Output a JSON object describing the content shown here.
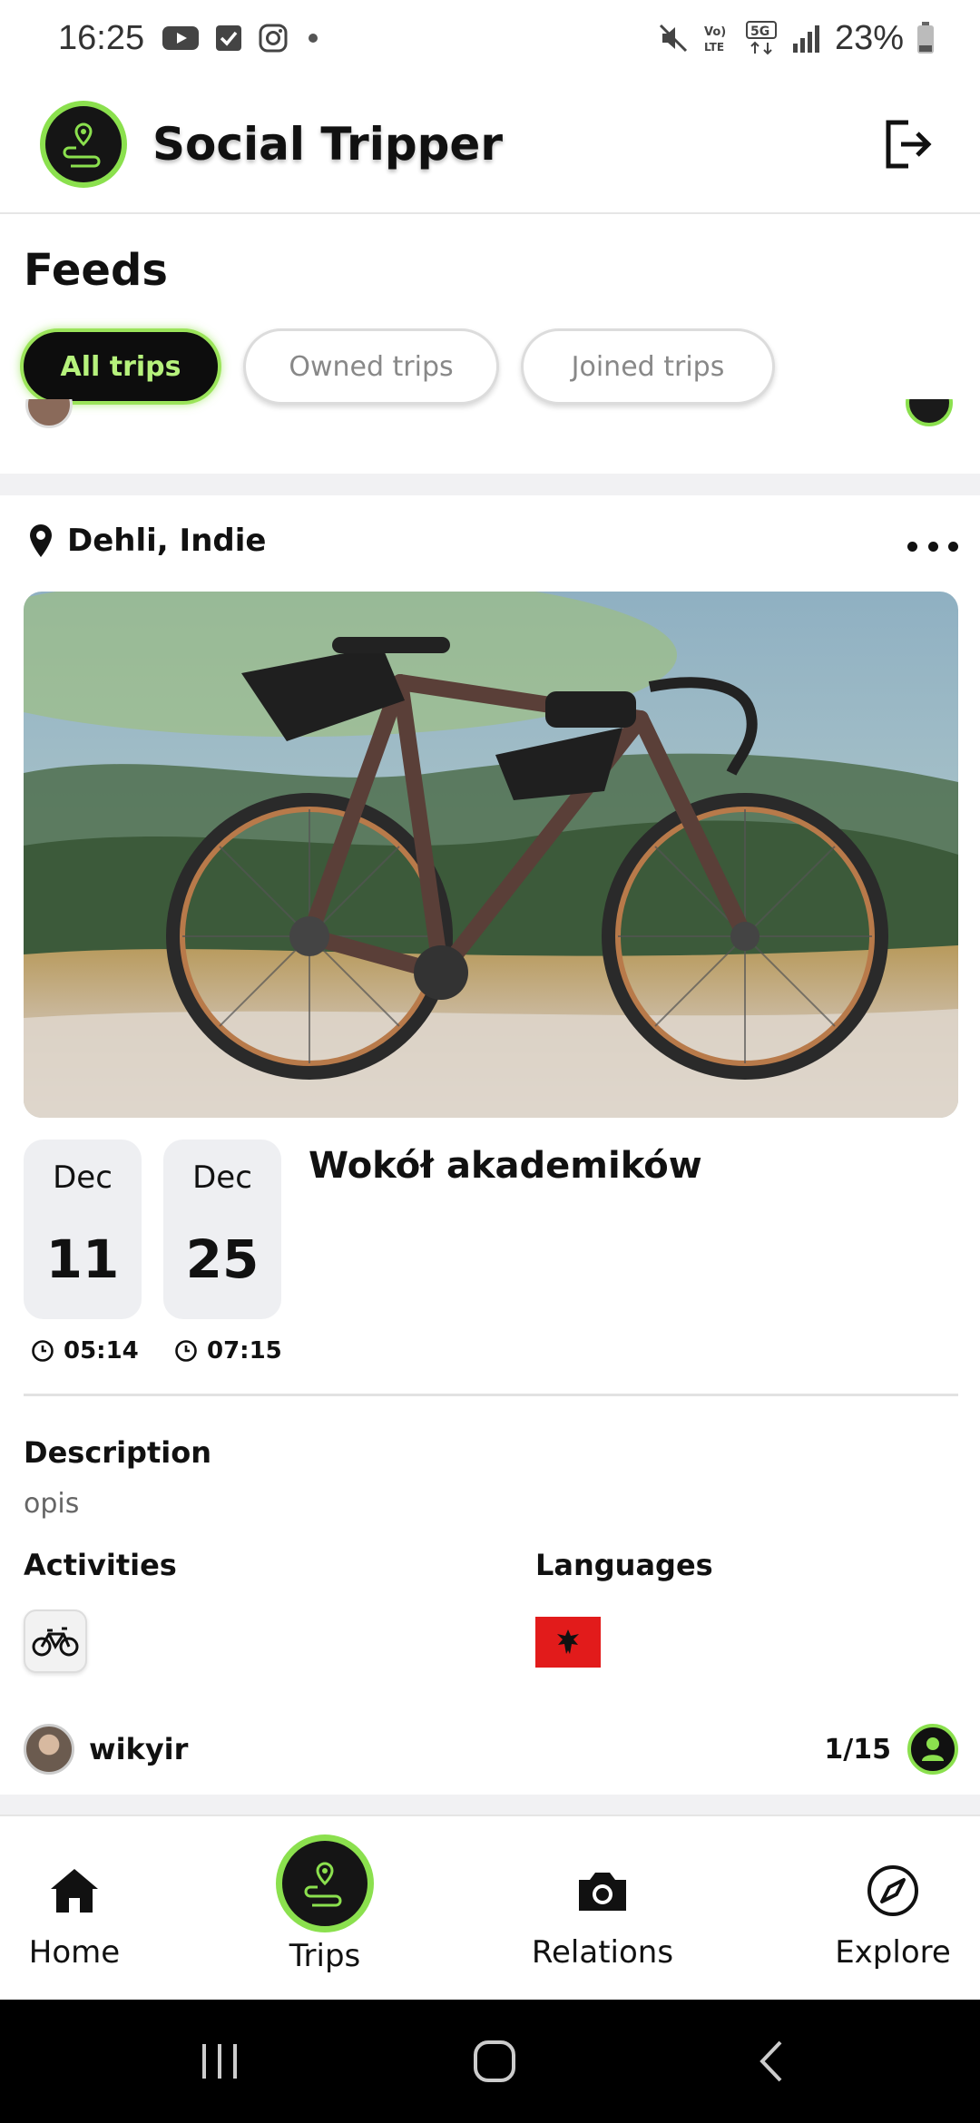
{
  "status_bar": {
    "time": "16:25",
    "battery": "23%"
  },
  "header": {
    "title": "Social Tripper"
  },
  "feeds": {
    "title": "Feeds",
    "tabs": [
      {
        "label": "All trips",
        "active": true
      },
      {
        "label": "Owned trips",
        "active": false
      },
      {
        "label": "Joined trips",
        "active": false
      }
    ]
  },
  "trip": {
    "location": "Dehli, Indie",
    "title": "Wokół akademików",
    "start": {
      "month": "Dec",
      "day": "11",
      "time": "05:14"
    },
    "end": {
      "month": "Dec",
      "day": "25",
      "time": "07:15"
    },
    "description_label": "Description",
    "description": "opis",
    "activities_label": "Activities",
    "languages_label": "Languages",
    "owner": "wikyir",
    "participants": "1/15"
  },
  "bottom_nav": [
    {
      "label": "Home",
      "icon": "home-icon"
    },
    {
      "label": "Trips",
      "icon": "route-icon",
      "active": true
    },
    {
      "label": "Relations",
      "icon": "camera-icon"
    },
    {
      "label": "Explore",
      "icon": "compass-icon"
    }
  ],
  "colors": {
    "accent": "#8be04e",
    "dark": "#151515"
  }
}
